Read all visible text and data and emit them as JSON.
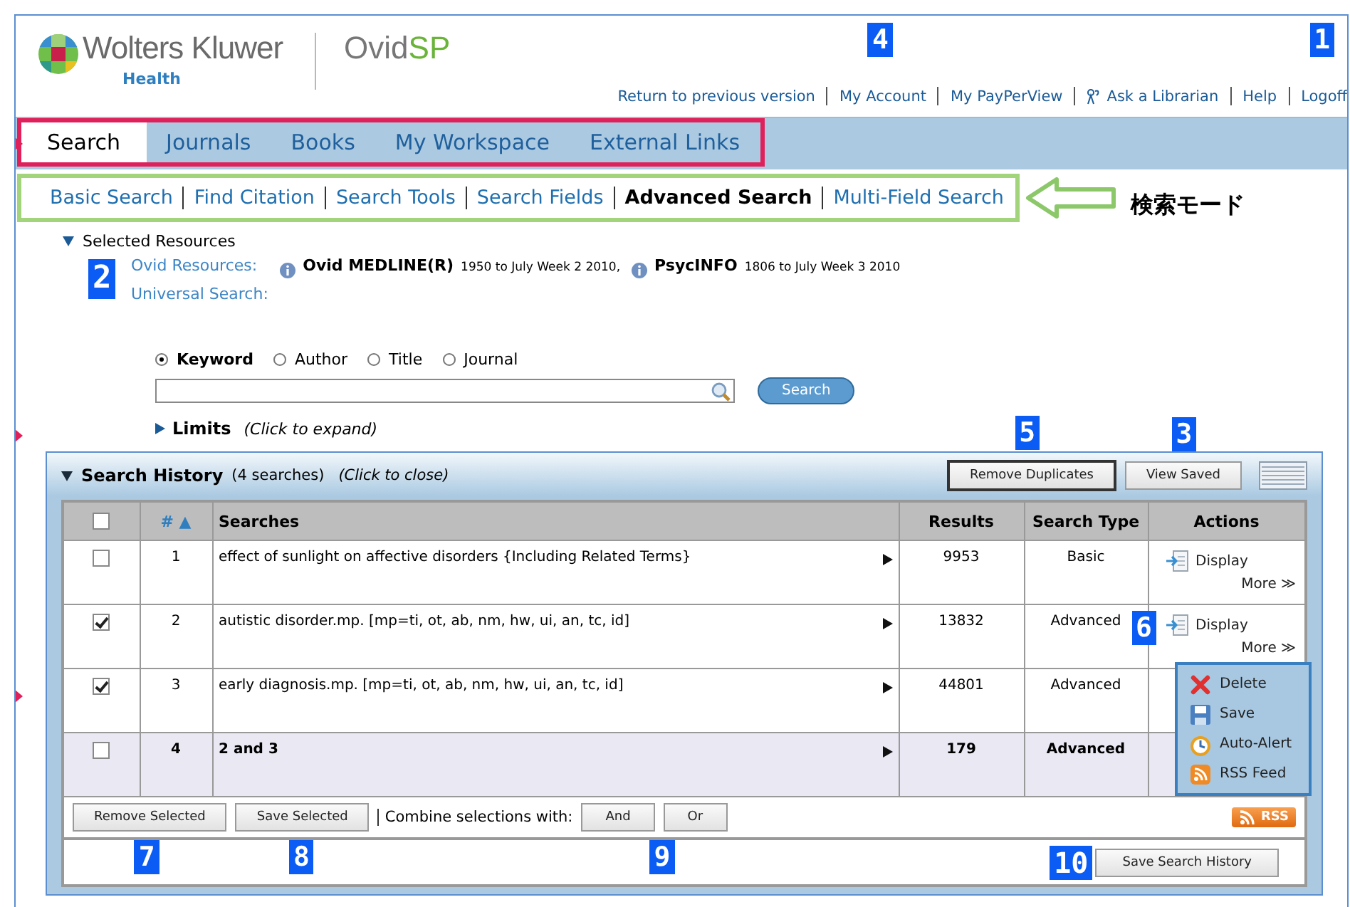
{
  "header": {
    "brand": "Wolters Kluwer",
    "division": "Health",
    "product": "Ovid",
    "product_suffix": "SP",
    "links": [
      {
        "label": "Return to previous version",
        "kind": "plain"
      },
      {
        "label": "My Account",
        "kind": "plain",
        "callout": "4"
      },
      {
        "label": "My PayPerView",
        "kind": "plain"
      },
      {
        "label": "Ask a Librarian",
        "kind": "librarian"
      },
      {
        "label": "Help",
        "kind": "plain"
      },
      {
        "label": "Logoff",
        "kind": "plain",
        "callout": "1"
      }
    ]
  },
  "tabs": [
    {
      "label": "Search",
      "selected": true
    },
    {
      "label": "Journals",
      "selected": false
    },
    {
      "label": "Books",
      "selected": false
    },
    {
      "label": "My Workspace",
      "selected": false
    },
    {
      "label": "External Links",
      "selected": false
    }
  ],
  "modes": {
    "items": [
      {
        "label": "Basic Search",
        "selected": false
      },
      {
        "label": "Find Citation",
        "selected": false
      },
      {
        "label": "Search Tools",
        "selected": false
      },
      {
        "label": "Search Fields",
        "selected": false
      },
      {
        "label": "Advanced Search",
        "selected": true
      },
      {
        "label": "Multi-Field Search",
        "selected": false
      }
    ],
    "note": "検索モード"
  },
  "resources": {
    "title": "Selected Resources",
    "callout": "2",
    "ovid_label": "Ovid Resources:",
    "universal_label": "Universal Search:",
    "databases": [
      {
        "name": "Ovid MEDLINE(R)",
        "coverage": "1950 to July Week 2 2010,"
      },
      {
        "name": "PsycINFO",
        "coverage": "1806 to July Week 3 2010"
      }
    ]
  },
  "search": {
    "fields": [
      {
        "label": "Keyword",
        "selected": true
      },
      {
        "label": "Author",
        "selected": false
      },
      {
        "label": "Title",
        "selected": false
      },
      {
        "label": "Journal",
        "selected": false
      }
    ],
    "button": "Search",
    "limits": "Limits",
    "limits_hint": "(Click to expand)"
  },
  "history": {
    "title": "Search History",
    "count": "(4 searches)",
    "hint": "(Click to close)",
    "buttons": [
      {
        "label": "Remove Duplicates",
        "callout": "5"
      },
      {
        "label": "View Saved",
        "callout": "3"
      }
    ],
    "select_all_checked": false,
    "columns": {
      "number": "#",
      "sort_mark": "▲",
      "searches": "Searches",
      "results": "Results",
      "type": "Search Type",
      "actions": "Actions"
    },
    "rows": [
      {
        "checked": false,
        "number": "1",
        "query": "effect of sunlight on affective disorders {Including Related Terms}",
        "results": "9953",
        "type": "Basic",
        "combined": false,
        "display": "Display",
        "more": "More ≫"
      },
      {
        "checked": true,
        "number": "2",
        "query": "autistic disorder.mp. [mp=ti, ot, ab, nm, hw, ui, an, tc, id]",
        "results": "13832",
        "type": "Advanced",
        "combined": false,
        "display": "Display",
        "more": "More ≫",
        "callout": "6",
        "menu": [
          {
            "label": "Delete",
            "kind": "delete"
          },
          {
            "label": "Save",
            "kind": "save"
          },
          {
            "label": "Auto-Alert",
            "kind": "alert"
          },
          {
            "label": "RSS Feed",
            "kind": "rss"
          }
        ]
      },
      {
        "checked": true,
        "number": "3",
        "query": "early diagnosis.mp. [mp=ti, ot, ab, nm, hw, ui, an, tc, id]",
        "results": "44801",
        "type": "Advanced",
        "combined": false
      },
      {
        "checked": false,
        "number": "4",
        "query": "2 and 3",
        "results": "179",
        "type": "Advanced",
        "combined": true
      }
    ],
    "footer_buttons": [
      {
        "label": "Remove Selected",
        "callout": "7"
      },
      {
        "label": "Save Selected",
        "callout": "8"
      }
    ],
    "combine_label": "Combine selections with:",
    "combine_buttons": [
      {
        "label": "And",
        "callout": "9"
      },
      {
        "label": "Or"
      }
    ],
    "rss": "RSS",
    "save_button": {
      "label": "Save Search History",
      "callout": "10"
    }
  }
}
